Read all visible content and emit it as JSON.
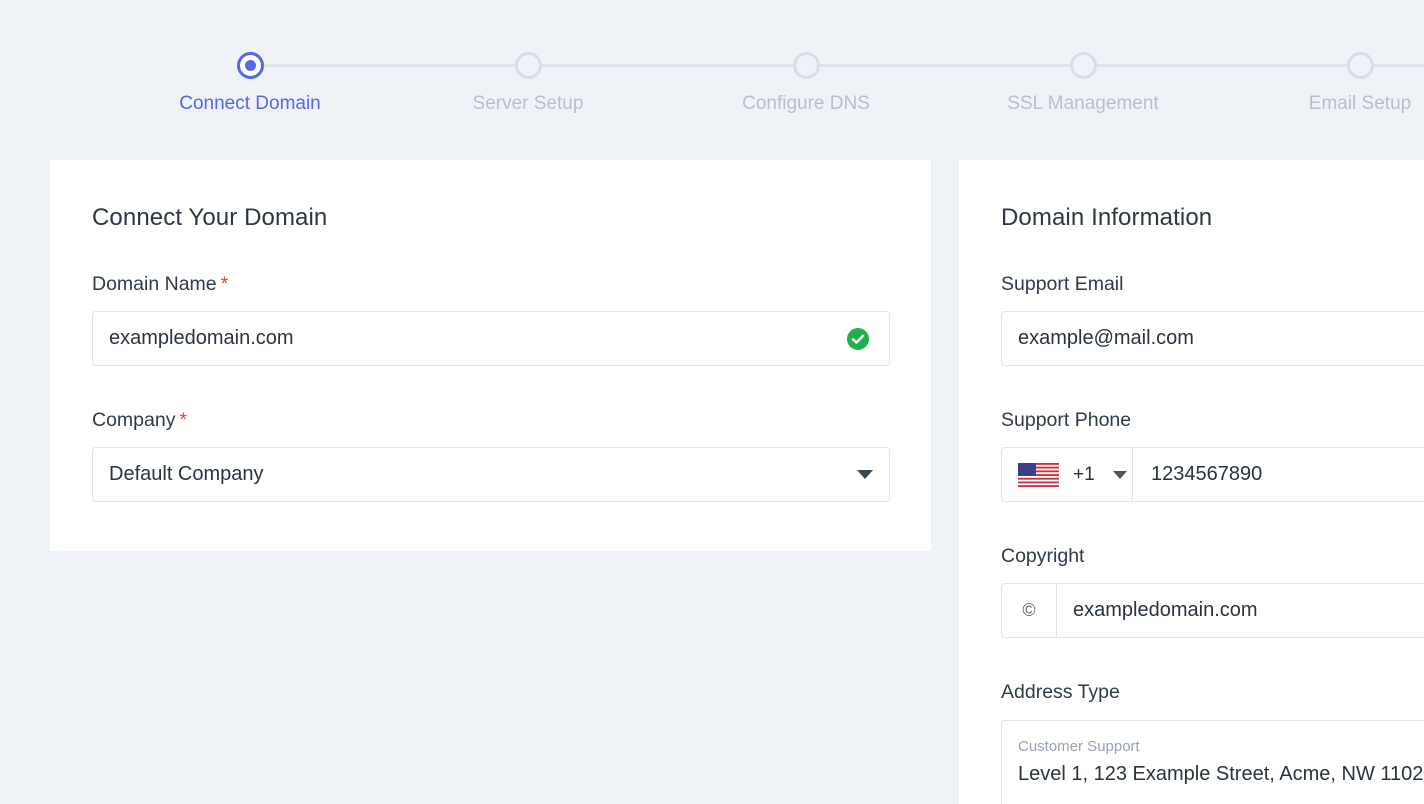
{
  "stepper": {
    "steps": [
      {
        "label": "Connect Domain",
        "state": "active"
      },
      {
        "label": "Server Setup",
        "state": "pending"
      },
      {
        "label": "Configure DNS",
        "state": "pending"
      },
      {
        "label": "SSL Management",
        "state": "pending"
      },
      {
        "label": "Email Setup",
        "state": "pending"
      }
    ]
  },
  "connect_card": {
    "title": "Connect Your Domain",
    "domain_name": {
      "label": "Domain Name",
      "required_mark": "*",
      "value": "exampledomain.com",
      "status": "valid"
    },
    "company": {
      "label": "Company",
      "required_mark": "*",
      "selected": "Default Company"
    }
  },
  "info_card": {
    "title": "Domain Information",
    "support_email": {
      "label": "Support Email",
      "value": "example@mail.com"
    },
    "support_phone": {
      "label": "Support Phone",
      "country": "US",
      "dial_code": "+1",
      "value": "1234567890"
    },
    "copyright": {
      "label": "Copyright",
      "symbol": "©",
      "value": "exampledomain.com"
    },
    "address_type": {
      "label": "Address Type",
      "caption": "Customer Support",
      "value": "Level 1, 123 Example Street, Acme, NW 1102"
    }
  },
  "colors": {
    "accent": "#5468e8",
    "success": "#22b04b",
    "required": "#e3453f",
    "background": "#eff3f8"
  }
}
